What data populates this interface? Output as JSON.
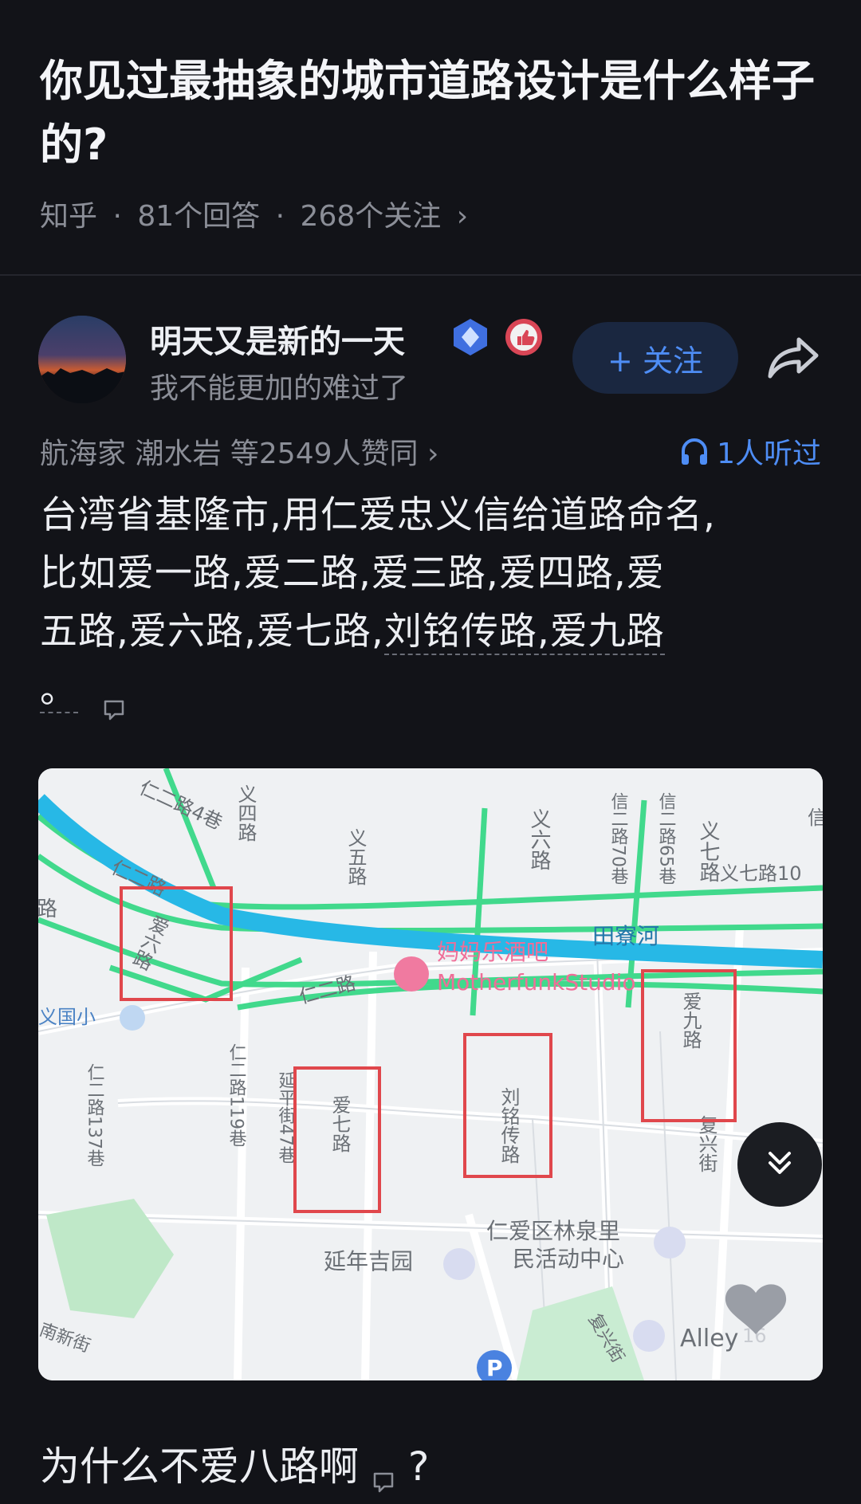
{
  "question": {
    "title": "你见过最抽象的城市道路设计是什么样子的?",
    "source": "知乎",
    "answers": "81个回答",
    "followers": "268个关注",
    "sep": "·",
    "chevron": "›"
  },
  "answer": {
    "author_name": "明天又是新的一天",
    "author_bio": "我不能更加的难过了",
    "follow_label": "+ 关注",
    "agree_text": "航海家 潮水岩 等2549人赞同 ›",
    "listen_text": "1人听过",
    "body_line1": "台湾省基隆市,用仁爱忠义信给道路命名,",
    "body_line2": "比如爱一路,爱二路,爱三路,爱四路,爱",
    "body_line3_a": "五路,爱六路,爱七路,",
    "body_line3_b": "刘铭传路,爱九路",
    "body_line4": "。",
    "closing_text": "为什么不爱八路啊",
    "closing_mark": "?"
  },
  "map": {
    "labels": {
      "ren_er_4": "仁二路4巷",
      "yi_si": "义四路",
      "yi_wu": "义五路",
      "yi_liu": "义六路",
      "xin_70": "信二路70巷",
      "xin_65": "信二路65巷",
      "yi_qi": "义七路",
      "yi_qi_10": "义七路10",
      "tian_liao_he": "田寮河",
      "ren_er_upper": "仁二路",
      "ai_liu": "爱六路",
      "bar_cn": "妈妈乐酒吧",
      "bar_en": "MotherfunkStudio",
      "ren_er_mid": "仁二路",
      "guoxiao": "义国小",
      "ren_er_119": "仁二路119巷",
      "ren_er_137": "仁二路137巷",
      "yanping_47": "延平街47巷",
      "ai_qi": "爱七路",
      "liu_ming_chuan": "刘铭传路",
      "ai_jiu": "爱九路",
      "fu_xing": "复兴街",
      "lin_quan": "仁爱区林泉里",
      "activity_center": "民活动中心",
      "yan_nian": "延年吉园",
      "nan_xin": "南新街",
      "fu_xing_2": "复兴街",
      "alley": "Alley",
      "alley_num": "16",
      "parking": "P",
      "lu": "路",
      "xin_edge": "信"
    },
    "colors": {
      "river": "#27b8e6",
      "road_green": "#41d98c",
      "highlight_box": "#e0474c",
      "pink_poi": "#f07aa0"
    }
  },
  "icons": {
    "verified": "blue-diamond-badge-icon",
    "like_badge": "thumbs-up-badge-icon",
    "share": "share-arrow-icon",
    "headphones": "headphones-icon",
    "comment": "comment-bubble-icon",
    "scroll": "double-chevron-down-icon",
    "heart": "heart-icon"
  }
}
